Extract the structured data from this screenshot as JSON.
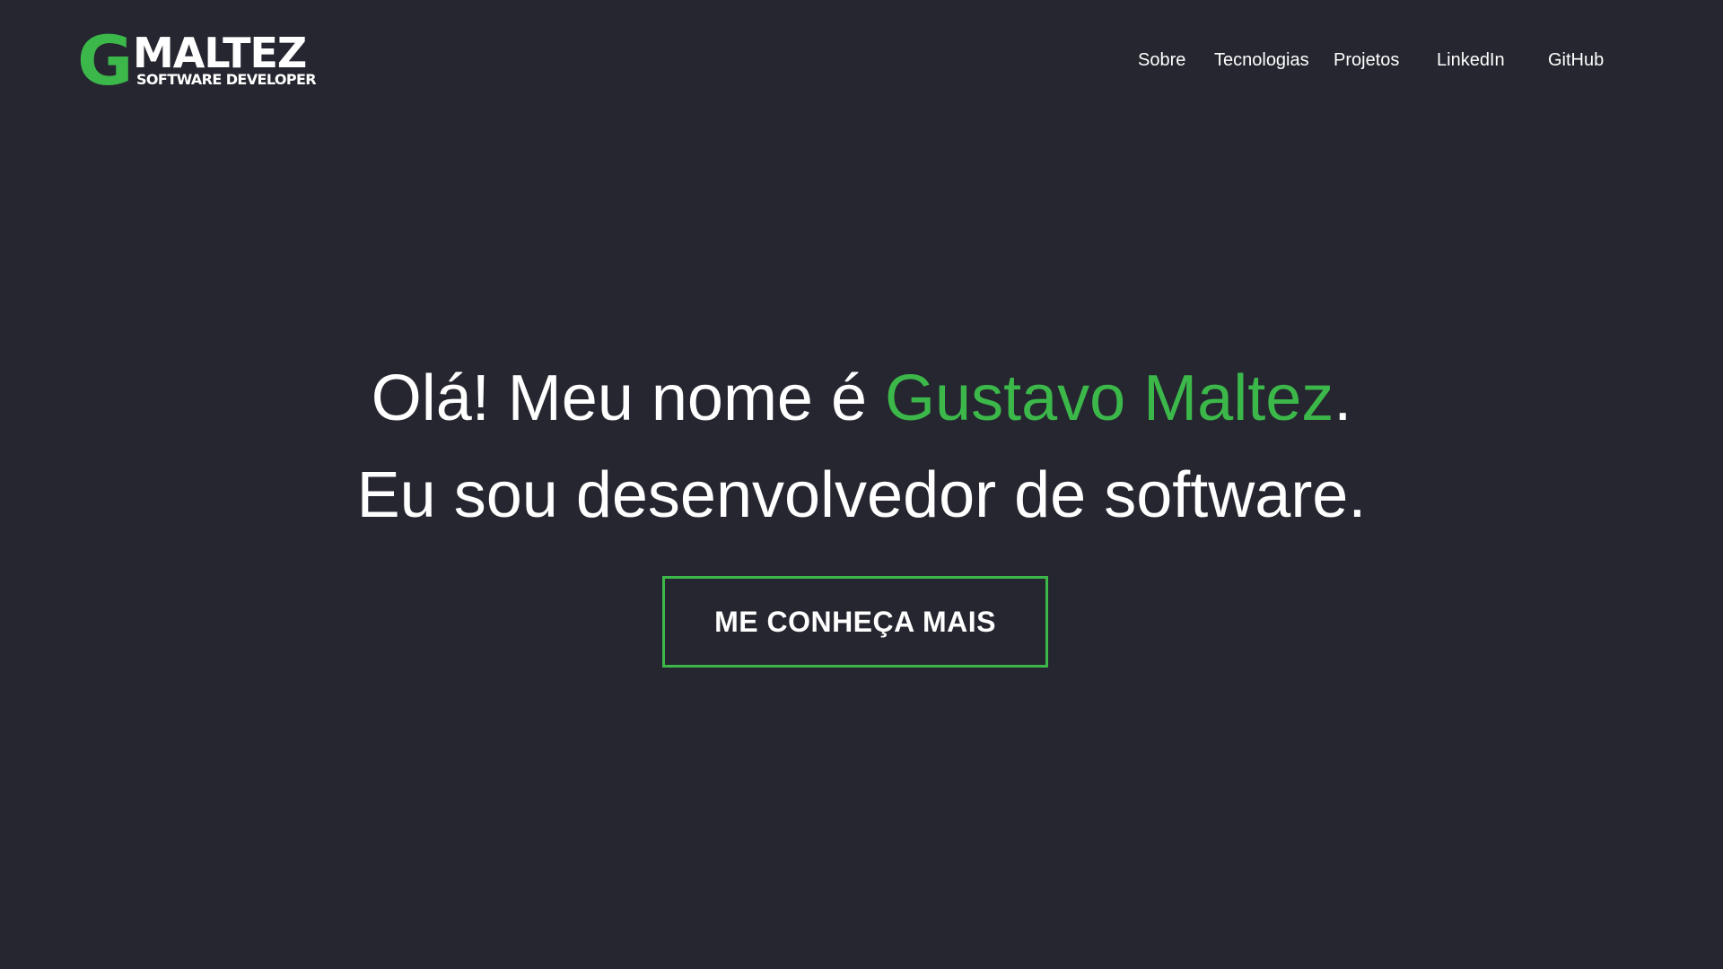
{
  "logo": {
    "letter": "G",
    "name": "MALTEZ",
    "tagline": "SOFTWARE DEVELOPER"
  },
  "nav": {
    "items": [
      {
        "label": "Sobre"
      },
      {
        "label": "Tecnologias"
      },
      {
        "label": "Projetos"
      },
      {
        "label": "LinkedIn"
      },
      {
        "label": "GitHub"
      }
    ]
  },
  "hero": {
    "line1_prefix": "Olá! Meu nome é ",
    "line1_name": "Gustavo Maltez",
    "line1_suffix": ".",
    "line2": "Eu sou desenvolvedor de software."
  },
  "cta": {
    "label": "ME CONHEÇA MAIS"
  },
  "colors": {
    "background": "#25262f",
    "accent": "#3cb84a",
    "text": "#ffffff"
  }
}
